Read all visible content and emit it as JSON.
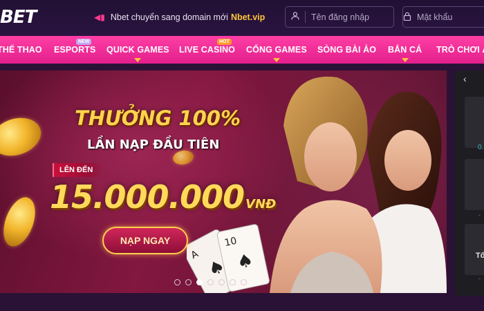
{
  "header": {
    "logo": "BET",
    "notice_text": "Nbet chuyển sang domain mới",
    "notice_domain": "Nbet.vip",
    "notice_icon": "megaphone-icon",
    "username_placeholder": "Tên đăng nhập",
    "password_placeholder": "Mật khẩu"
  },
  "nav": {
    "items": [
      {
        "label": "THỂ THAO"
      },
      {
        "label": "ESPORTS",
        "badge": "NEW"
      },
      {
        "label": "QUICK GAMES",
        "dropdown": true
      },
      {
        "label": "LIVE CASINO",
        "badge": "HOT"
      },
      {
        "label": "CỔNG GAMES",
        "dropdown": true
      },
      {
        "label": "SÒNG BÀI ẢO"
      },
      {
        "label": "BẮN CÁ",
        "dropdown": true
      },
      {
        "label": "TRÒ CHƠI Ả"
      }
    ],
    "accent": "#ff3ea5",
    "caret_color": "#ffc53a"
  },
  "banner": {
    "title": "THƯỞNG 100%",
    "subtitle": "LẦN NẠP ĐẦU TIÊN",
    "upto_label": "LÊN ĐẾN",
    "amount": "15.000.000",
    "currency": "VNĐ",
    "cta_label": "NẠP NGAY",
    "slide_count": 7,
    "active_slide": 3
  },
  "side_panel": {
    "chevron": "chevron-left-icon",
    "values": [
      "0.",
      "-",
      "Tổ",
      "-"
    ]
  }
}
